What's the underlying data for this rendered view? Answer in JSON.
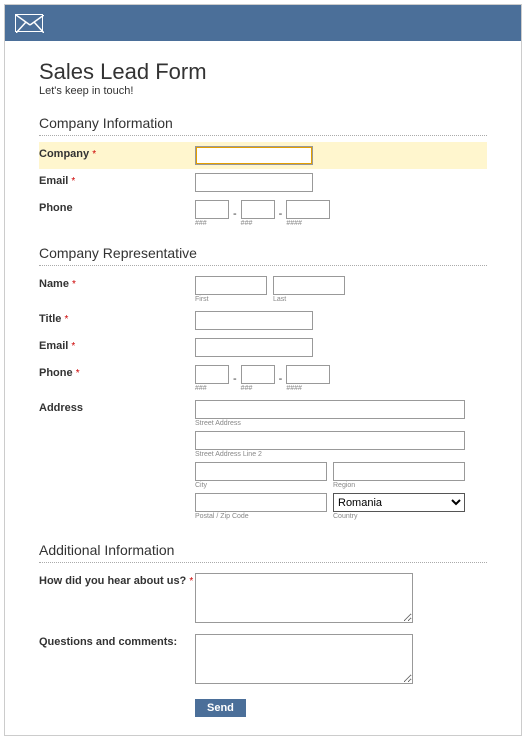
{
  "header": {
    "icon": "mail-icon"
  },
  "title": "Sales Lead Form",
  "subtitle": "Let's keep in touch!",
  "sections": {
    "company_info": {
      "heading": "Company Information",
      "company": {
        "label": "Company",
        "required": true,
        "value": ""
      },
      "email": {
        "label": "Email",
        "required": true,
        "value": ""
      },
      "phone": {
        "label": "Phone",
        "required": false,
        "parts": [
          "",
          "",
          ""
        ],
        "hints": [
          "###",
          "###",
          "####"
        ]
      }
    },
    "representative": {
      "heading": "Company Representative",
      "name": {
        "label": "Name",
        "required": true,
        "first": "",
        "last": "",
        "hints": {
          "first": "First",
          "last": "Last"
        }
      },
      "title": {
        "label": "Title",
        "required": true,
        "value": ""
      },
      "email": {
        "label": "Email",
        "required": true,
        "value": ""
      },
      "phone": {
        "label": "Phone",
        "required": true,
        "parts": [
          "",
          "",
          ""
        ],
        "hints": [
          "###",
          "###",
          "####"
        ]
      },
      "address": {
        "label": "Address",
        "required": false,
        "street1": "",
        "street2": "",
        "city": "",
        "region": "",
        "postal": "",
        "country": "Romania",
        "hints": {
          "street1": "Street Address",
          "street2": "Street Address Line 2",
          "city": "City",
          "region": "Region",
          "postal": "Postal / Zip Code",
          "country": "Country"
        }
      }
    },
    "additional": {
      "heading": "Additional Information",
      "hear": {
        "label": "How did you hear about us?",
        "required": true,
        "value": ""
      },
      "questions": {
        "label": "Questions and comments:",
        "required": false,
        "value": ""
      }
    }
  },
  "submit": {
    "label": "Send"
  },
  "required_marker": "*",
  "separator": "-"
}
